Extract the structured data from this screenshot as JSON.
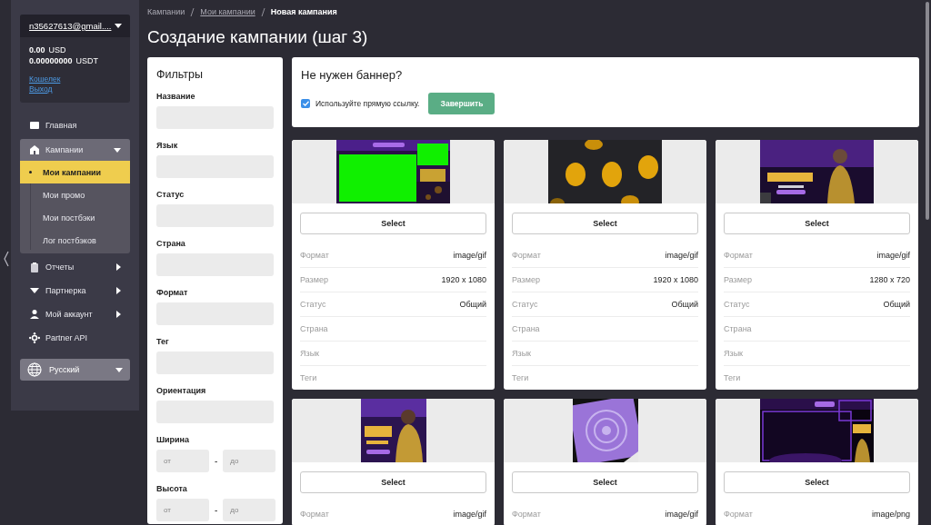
{
  "account": {
    "email": "n35627613@gmail....",
    "balances": [
      {
        "amount": "0.00",
        "currency": "USD"
      },
      {
        "amount": "0.00000000",
        "currency": "USDT"
      }
    ],
    "links": [
      "Кошелек",
      "Выход"
    ]
  },
  "nav": [
    {
      "label": "Главная"
    },
    {
      "label": "Кампании",
      "expanded": true,
      "children": [
        {
          "label": "Мои кампании",
          "selected": true
        },
        {
          "label": "Мои промо",
          "selected": false
        },
        {
          "label": "Мои постбэки",
          "selected": false
        },
        {
          "label": "Лог постбэков",
          "selected": false
        }
      ]
    },
    {
      "label": "Отчеты",
      "expanded": false
    },
    {
      "label": "Партнерка",
      "expanded": false
    },
    {
      "label": "Мой аккаунт",
      "expanded": false
    },
    {
      "label": "Partner API"
    }
  ],
  "language": "Русский",
  "breadcrumbs": [
    {
      "label": "Кампании",
      "link": false
    },
    {
      "label": "Мои кампании",
      "link": true
    },
    {
      "label": "Новая кампания",
      "link": false
    }
  ],
  "title": "Создание кампании (шаг 3)",
  "filters": {
    "title": "Фильтры",
    "fields": [
      {
        "kind": "text",
        "label": "Название"
      },
      {
        "kind": "text",
        "label": "Язык"
      },
      {
        "kind": "text",
        "label": "Статус"
      },
      {
        "kind": "text",
        "label": "Страна"
      },
      {
        "kind": "text",
        "label": "Формат"
      },
      {
        "kind": "text",
        "label": "Тег"
      },
      {
        "kind": "text",
        "label": "Ориентация"
      },
      {
        "kind": "range",
        "label": "Ширина",
        "from_placeholder": "от",
        "separator": "-",
        "to_placeholder": "до"
      },
      {
        "kind": "range",
        "label": "Высота",
        "from_placeholder": "от",
        "separator": "-",
        "to_placeholder": "до"
      }
    ]
  },
  "direct_link": {
    "title": "Не нужен баннер?",
    "checkbox_label": "Используйте прямую ссылку.",
    "checked": true,
    "button": "Завершить"
  },
  "banners": [
    {
      "button": "Select",
      "details": [
        {
          "label": "Формат",
          "value": "image/gif"
        },
        {
          "label": "Размер",
          "value": "1920 x 1080"
        },
        {
          "label": "Статус",
          "value": "Общий"
        },
        {
          "label": "Страна"
        },
        {
          "label": "Язык"
        },
        {
          "label": "Теги"
        }
      ]
    },
    {
      "button": "Select",
      "details": [
        {
          "label": "Формат",
          "value": "image/gif"
        },
        {
          "label": "Размер",
          "value": "1920 x 1080"
        },
        {
          "label": "Статус",
          "value": "Общий"
        },
        {
          "label": "Страна"
        },
        {
          "label": "Язык"
        },
        {
          "label": "Теги"
        }
      ]
    },
    {
      "button": "Select",
      "details": [
        {
          "label": "Формат",
          "value": "image/gif"
        },
        {
          "label": "Размер",
          "value": "1280 x 720"
        },
        {
          "label": "Статус",
          "value": "Общий"
        },
        {
          "label": "Страна"
        },
        {
          "label": "Язык"
        },
        {
          "label": "Теги"
        }
      ]
    },
    {
      "button": "Select",
      "details": [
        {
          "label": "Формат",
          "value": "image/gif"
        }
      ]
    },
    {
      "button": "Select",
      "details": [
        {
          "label": "Формат",
          "value": "image/gif"
        }
      ]
    },
    {
      "button": "Select",
      "details": [
        {
          "label": "Формат",
          "value": "image/png"
        }
      ]
    }
  ]
}
